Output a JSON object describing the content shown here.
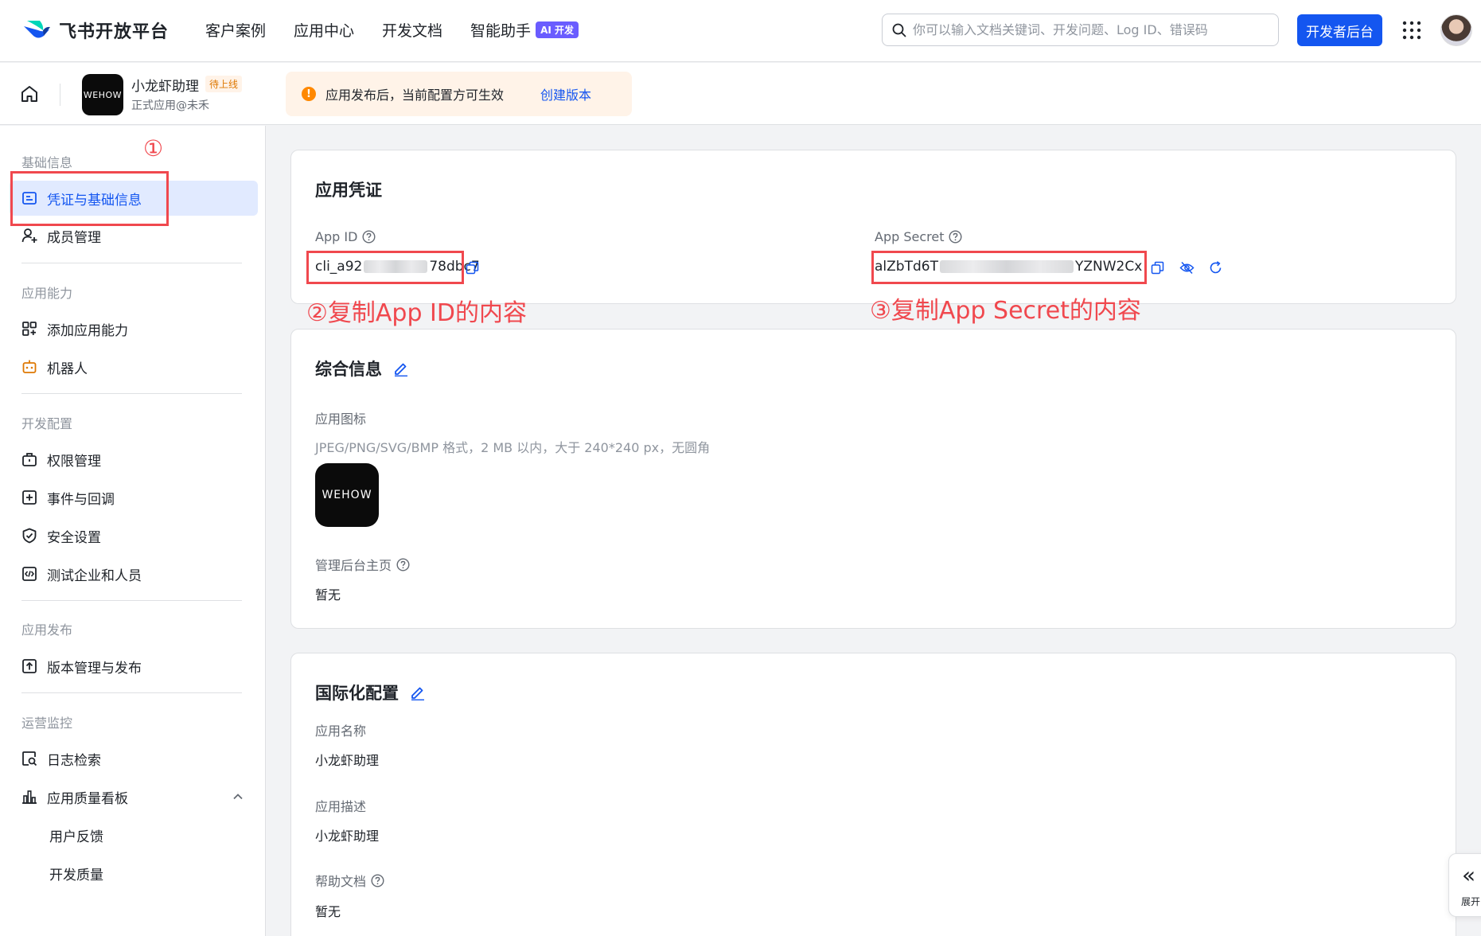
{
  "topbar": {
    "logo_text": "飞书开放平台",
    "nav": [
      "客户案例",
      "应用中心",
      "开发文档",
      "智能助手"
    ],
    "ai_badge": "AI 开发",
    "search_placeholder": "你可以输入文档关键词、开发问题、Log ID、错误码",
    "dev_button": "开发者后台"
  },
  "app": {
    "name": "小龙虾助理",
    "status": "待上线",
    "subtitle": "正式应用@未禾",
    "logo_text": "WEHOW",
    "notice_text": "应用发布后，当前配置方可生效",
    "notice_link": "创建版本"
  },
  "sidebar": {
    "groups": [
      {
        "label": "基础信息",
        "items": [
          "凭证与基础信息",
          "成员管理"
        ]
      },
      {
        "label": "应用能力",
        "items": [
          "添加应用能力",
          "机器人"
        ]
      },
      {
        "label": "开发配置",
        "items": [
          "权限管理",
          "事件与回调",
          "安全设置",
          "测试企业和人员"
        ]
      },
      {
        "label": "应用发布",
        "items": [
          "版本管理与发布"
        ]
      },
      {
        "label": "运营监控",
        "items": [
          "日志检索",
          "应用质量看板"
        ]
      }
    ],
    "sub_items": [
      "用户反馈",
      "开发质量"
    ]
  },
  "credentials": {
    "title": "应用凭证",
    "app_id_label": "App ID",
    "app_id_start": "cli_a92",
    "app_id_end": "78dbc7",
    "app_secret_label": "App Secret",
    "app_secret_start": "alZbTd6T",
    "app_secret_end": "YZNW2Cx"
  },
  "general": {
    "title": "综合信息",
    "icon_label": "应用图标",
    "icon_hint": "JPEG/PNG/SVG/BMP 格式，2 MB 以内，大于 240*240 px，无圆角",
    "admin_label": "管理后台主页",
    "admin_value": "暂无"
  },
  "i18n": {
    "title": "国际化配置",
    "name_label": "应用名称",
    "name_value": "小龙虾助理",
    "desc_label": "应用描述",
    "desc_value": "小龙虾助理",
    "help_label": "帮助文档",
    "help_value": "暂无"
  },
  "annotations": {
    "step1": "①",
    "step2": "②复制App ID的内容",
    "step3": "③复制App Secret的内容"
  },
  "expand_tab": {
    "label": "展开"
  },
  "colors": {
    "primary": "#1456f0",
    "annotation": "#f0484e",
    "warning": "#ff8800"
  }
}
